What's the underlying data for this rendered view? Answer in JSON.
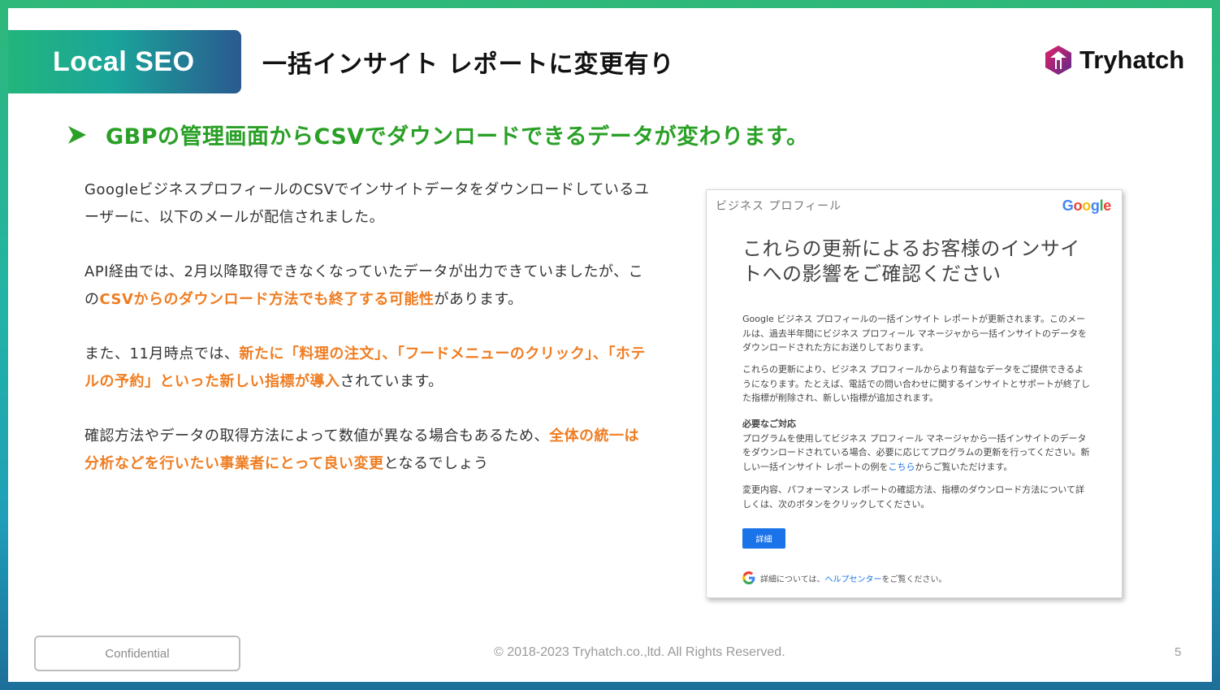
{
  "header": {
    "badge_label": "Local SEO",
    "title": "一括インサイト レポートに変更有り",
    "logo_text": "Tryhatch"
  },
  "headline": "GBPの管理画面からCSVでダウンロードできるデータが変わります。",
  "body": {
    "p1": "GoogleビジネスプロフィールのCSVでインサイトデータをダウンロードしているユーザーに、以下のメールが配信されました。",
    "p2_before": "API経由では、2月以降取得できなくなっていたデータが出力できていましたが、この",
    "p2_highlight": "CSVからのダウンロード方法でも終了する可能性",
    "p2_after": "があります。",
    "p3_before": "また、11月時点では、",
    "p3_highlight": "新たに「料理の注文」、「フードメニューのクリック」、「ホテルの予約」といった新しい指標が導入",
    "p3_after": "されています。",
    "p4_before": "確認方法やデータの取得方法によって数値が異なる場合もあるため、",
    "p4_highlight": "全体の統一は分析などを行いたい事業者にとって良い変更",
    "p4_after": "となるでしょう"
  },
  "email": {
    "service_label": "ビジネス プロフィール",
    "google_logo": "Google",
    "title": "これらの更新によるお客様のインサイトへの影響をご確認ください",
    "para1": "Google ビジネス プロフィールの一括インサイト レポートが更新されます。このメールは、過去半年間にビジネス プロフィール マネージャから一括インサイトのデータをダウンロードされた方にお送りしております。",
    "para2": "これらの更新により、ビジネス プロフィールからより有益なデータをご提供できるようになります。たとえば、電話での問い合わせに関するインサイトとサポートが終了した指標が削除され、新しい指標が追加されます。",
    "para3_heading": "必要なご対応",
    "para3_before": "プログラムを使用してビジネス プロフィール マネージャから一括インサイトのデータをダウンロードされている場合、必要に応じてプログラムの更新を行ってください。新しい一括インサイト レポートの例を",
    "para3_link": "こちら",
    "para3_after": "からご覧いただけます。",
    "para4": "変更内容、パフォーマンス レポートの確認方法、指標のダウンロード方法について詳しくは、次のボタンをクリックしてください。",
    "button_label": "詳細",
    "footer_before": "詳細については、",
    "footer_link": "ヘルプセンター",
    "footer_after": "をご覧ください。"
  },
  "footer": {
    "confidential": "Confidential",
    "copyright": "© 2018-2023 Tryhatch.co.,ltd. All Rights Reserved.",
    "page_number": "5"
  },
  "colors": {
    "headline_green": "#2aa026",
    "highlight_orange": "#ef7d22",
    "google_blue": "#1a73e8"
  }
}
